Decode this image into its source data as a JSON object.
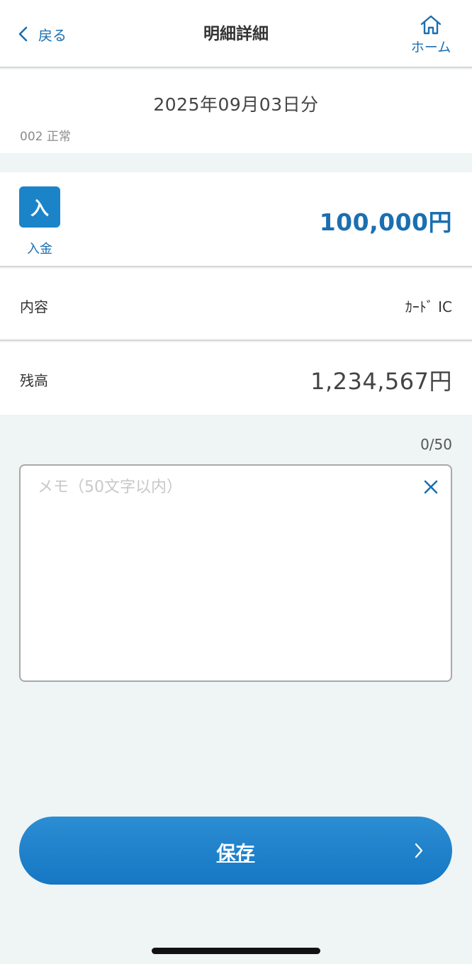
{
  "header": {
    "back_label": "戻る",
    "title": "明細詳細",
    "home_label": "ホーム"
  },
  "statement": {
    "date": "2025年09月03日分",
    "account": "002 正常"
  },
  "transaction": {
    "badge": "入",
    "type_label": "入金",
    "amount": "100,000円"
  },
  "details": {
    "content_label": "内容",
    "content_value": "ｶｰﾄﾞ IC",
    "balance_label": "残高",
    "balance_value": "1,234,567円"
  },
  "memo": {
    "counter": "0/50",
    "placeholder": "メモ（50文字以内）",
    "value": ""
  },
  "actions": {
    "save_label": "保存"
  },
  "colors": {
    "accent": "#1a6fb0",
    "button": "#1b84c9",
    "background": "#eff4f4"
  }
}
